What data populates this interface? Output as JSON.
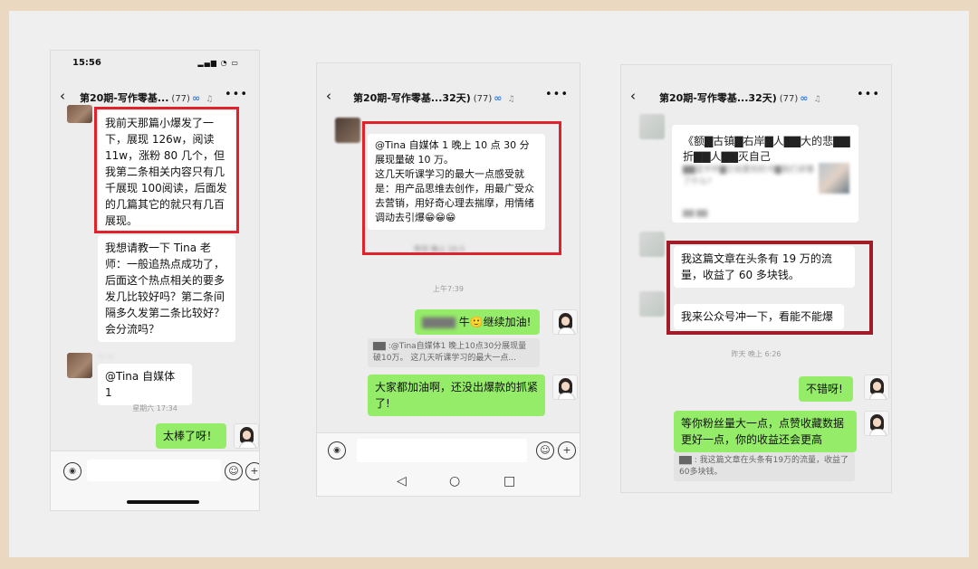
{
  "panel1": {
    "status_time": "15:56",
    "status_icons": "▂▄▆ ◔ ▭",
    "header": {
      "back": "‹",
      "title": "第20期-写作零基...",
      "count": "(77)",
      "chain": "∞",
      "bell": "♫",
      "more": "•••"
    },
    "messages": [
      {
        "text": "我前天那篇小爆发了一下，展现 126w，阅读11w，涨粉 80 几个，但我第二条相关内容只有几千展现 100阅读，后面发的几篇其它的就只有几百展现。"
      },
      {
        "text": "我想请教一下 Tina 老师：一般追热点成功了，后面这个热点相关的要多发几比较好吗？第二条间隔多久发第二条比较好？会分流吗？"
      },
      {
        "text": "@Tina 自媒体 1"
      }
    ],
    "sender_name": "··· ···",
    "timestamp": "星期六 17:34",
    "reply": "太棒了呀！",
    "input": {
      "voice": "◉",
      "emoji": "☺",
      "plus": "+"
    }
  },
  "panel2": {
    "header": {
      "back": "‹",
      "title": "第20期-写作零基...32天)",
      "count": "(77)",
      "chain": "∞",
      "bell": "♫",
      "more": "•••"
    },
    "message": "@Tina 自媒体 1  晚上 10 点 30 分展现量破 10 万。\n这几天听课学习的最大一点感受就是：用产品思维去创作，用最广受众去营销，用好奇心理去揣摩，用情绪调动去引爆😁😁😁",
    "faded_ts": "昨天 晚上 10:3",
    "timestamp": "上午7:39",
    "reply1_blur": "▇▇▇▇",
    "reply1": " 牛🙂继续加油!",
    "quote": "▇▇ :@Tina自媒体1 晚上10点30分展现量破10万。 这几天听课学习的最大一点...",
    "reply2": "大家都加油啊，还没出爆款的抓紧了!",
    "input": {
      "voice": "◉",
      "emoji": "☺",
      "plus": "+"
    },
    "nav": {
      "back": "◁",
      "home": "○",
      "recent": "□"
    }
  },
  "panel3": {
    "header": {
      "back": "‹",
      "title": "第20期-写作零基...32天)",
      "count": "(77)",
      "chain": "∞",
      "bell": "♫",
      "more": "•••"
    },
    "article": {
      "title": "《额▇古镇▇右岸▇人▇▇大的悲▇▇折▇▇人▇▇灭自己",
      "desc": "▇▇蓝宇杯▇忘铭要刻的书▇我们读懂了什么?",
      "foot": "▇▇ ▇▇"
    },
    "message1": "我这篇文章在头条有 19 万的流量，收益了 60 多块钱。",
    "message2": "我来公众号冲一下，看能不能爆",
    "timestamp": "昨天 晚上 6:26",
    "reply1": "不错呀!",
    "reply2": "等你粉丝量大一点，点赞收藏数据更好一点，你的收益还会更高",
    "quote": "▇▇ : 我这篇文章在头条有19万的流量，收益了60多块钱。"
  }
}
